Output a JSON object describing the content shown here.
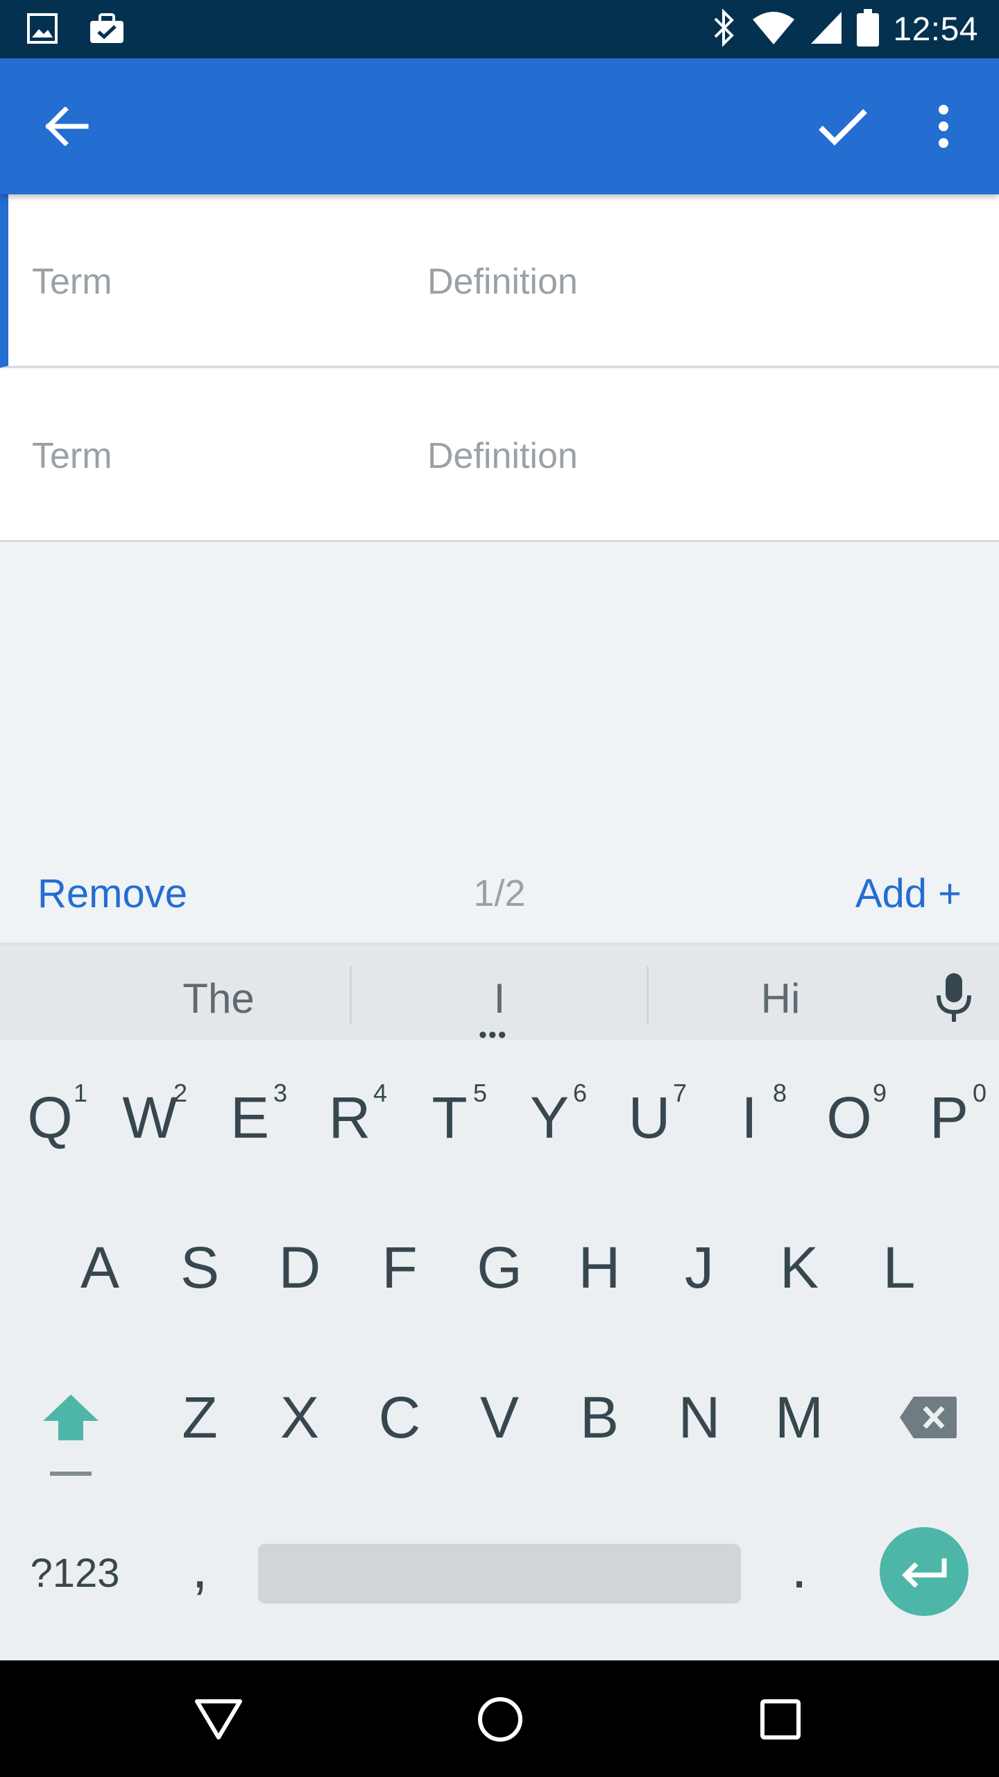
{
  "status_bar": {
    "time": "12:54",
    "left_icons": [
      "image-notification-icon",
      "briefcase-check-icon"
    ],
    "right_icons": [
      "bluetooth-icon",
      "wifi-icon",
      "cell-signal-icon",
      "battery-icon"
    ]
  },
  "app_bar": {
    "back_icon": "arrow-left-icon",
    "confirm_icon": "check-icon",
    "more_icon": "more-vertical-icon",
    "color": "#246dd1"
  },
  "rows": [
    {
      "term_placeholder": "Term",
      "definition_placeholder": "Definition",
      "active": true
    },
    {
      "term_placeholder": "Term",
      "definition_placeholder": "Definition",
      "active": false
    }
  ],
  "action_bar": {
    "remove_label": "Remove",
    "page_indicator": "1/2",
    "add_label": "Add +"
  },
  "keyboard": {
    "suggestions": [
      "The",
      "I",
      "Hi"
    ],
    "more_dots": "•••",
    "row1": [
      {
        "key": "Q",
        "hint": "1"
      },
      {
        "key": "W",
        "hint": "2"
      },
      {
        "key": "E",
        "hint": "3"
      },
      {
        "key": "R",
        "hint": "4"
      },
      {
        "key": "T",
        "hint": "5"
      },
      {
        "key": "Y",
        "hint": "6"
      },
      {
        "key": "U",
        "hint": "7"
      },
      {
        "key": "I",
        "hint": "8"
      },
      {
        "key": "O",
        "hint": "9"
      },
      {
        "key": "P",
        "hint": "0"
      }
    ],
    "row2": [
      "A",
      "S",
      "D",
      "F",
      "G",
      "H",
      "J",
      "K",
      "L"
    ],
    "row3": [
      "Z",
      "X",
      "C",
      "V",
      "B",
      "N",
      "M"
    ],
    "symbols_label": "?123",
    "comma_label": ",",
    "period_label": ".",
    "accent_color": "#4db6a8"
  },
  "nav_bar": {
    "icons": [
      "back-triangle-icon",
      "home-circle-icon",
      "recents-square-icon"
    ]
  }
}
